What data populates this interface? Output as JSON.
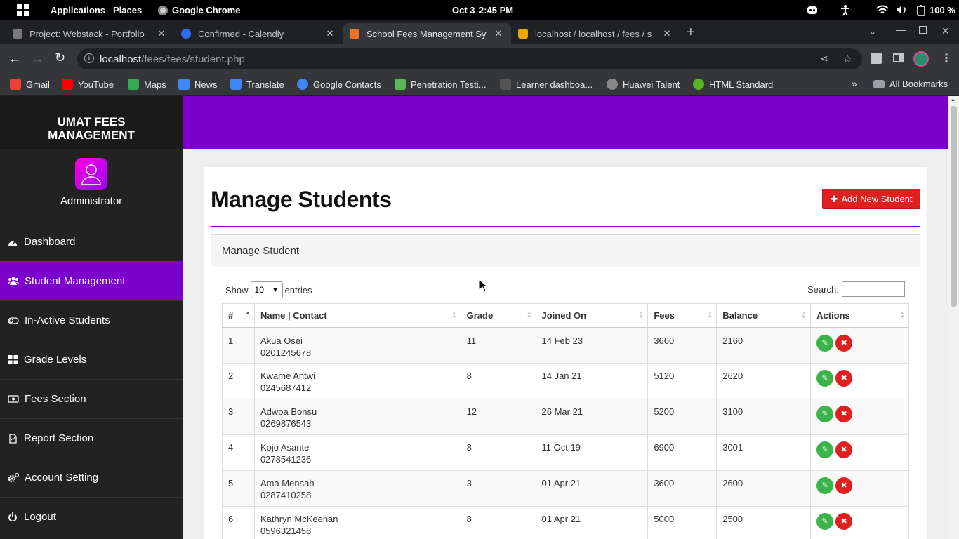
{
  "os": {
    "applications": "Applications",
    "places": "Places",
    "app": "Google Chrome",
    "date": "Oct 3",
    "time": "2:45 PM",
    "battery": "100 %"
  },
  "tabs": [
    {
      "title": "Project: Webstack - Portfolio",
      "color": "#7a7a7a"
    },
    {
      "title": "Confirmed - Calendly",
      "color": "#2f6ff5"
    },
    {
      "title": "School Fees Management Sy",
      "color": "#e8712a"
    },
    {
      "title": "localhost / localhost / fees / s",
      "color": "#e6a700"
    }
  ],
  "url": {
    "host": "localhost",
    "path": "/fees/fees/student.php"
  },
  "bookmarks": [
    {
      "label": "Gmail",
      "color": "#ea4335"
    },
    {
      "label": "YouTube",
      "color": "#ff0000"
    },
    {
      "label": "Maps",
      "color": "#34a853"
    },
    {
      "label": "News",
      "color": "#4285f4"
    },
    {
      "label": "Translate",
      "color": "#4285f4"
    },
    {
      "label": "Google Contacts",
      "color": "#4285f4"
    },
    {
      "label": "Penetration Testi...",
      "color": "#5bb55b"
    },
    {
      "label": "Learner dashboa...",
      "color": "#555555"
    },
    {
      "label": "Huawei Talent",
      "color": "#888888"
    },
    {
      "label": "HTML Standard",
      "color": "#5bb520"
    }
  ],
  "all_bookmarks": "All Bookmarks",
  "sidebar": {
    "brand_line1": "UMAT FEES",
    "brand_line2": "MANAGEMENT",
    "user": "Administrator",
    "items": [
      {
        "label": "Dashboard",
        "icon": "dashboard-icon"
      },
      {
        "label": "Student Management",
        "icon": "users-icon"
      },
      {
        "label": "In-Active Students",
        "icon": "toggle-off-icon"
      },
      {
        "label": "Grade Levels",
        "icon": "grid-icon"
      },
      {
        "label": "Fees Section",
        "icon": "money-icon"
      },
      {
        "label": "Report Section",
        "icon": "file-icon"
      },
      {
        "label": "Account Setting",
        "icon": "cogs-icon"
      },
      {
        "label": "Logout",
        "icon": "power-icon"
      }
    ]
  },
  "page": {
    "title": "Manage Students",
    "add_button": "Add New Student",
    "panel_title": "Manage Student",
    "show": "Show",
    "entries_value": "10",
    "entries": "entries",
    "search_label": "Search:"
  },
  "table": {
    "headers": [
      "#",
      "Name | Contact",
      "Grade",
      "Joined On",
      "Fees",
      "Balance",
      "Actions"
    ],
    "rows": [
      {
        "n": "1",
        "name": "Akua Osei",
        "contact": "0201245678",
        "grade": "11",
        "joined": "14 Feb 23",
        "fees": "3660",
        "balance": "2160"
      },
      {
        "n": "2",
        "name": "Kwame Antwi",
        "contact": "0245687412",
        "grade": "8",
        "joined": "14 Jan 21",
        "fees": "5120",
        "balance": "2620"
      },
      {
        "n": "3",
        "name": "Adwoa Bonsu",
        "contact": "0269876543",
        "grade": "12",
        "joined": "26 Mar 21",
        "fees": "5200",
        "balance": "3100"
      },
      {
        "n": "4",
        "name": "Kojo Asante",
        "contact": "0278541236",
        "grade": "8",
        "joined": "11 Oct 19",
        "fees": "6900",
        "balance": "3001"
      },
      {
        "n": "5",
        "name": "Ama Mensah",
        "contact": "0287410258",
        "grade": "3",
        "joined": "01 Apr 21",
        "fees": "3600",
        "balance": "2600"
      },
      {
        "n": "6",
        "name": "Kathryn McKeehan",
        "contact": "0596321458",
        "grade": "8",
        "joined": "01 Apr 21",
        "fees": "5000",
        "balance": "2500"
      }
    ]
  },
  "colors": {
    "accent": "#7b00c9",
    "danger": "#e02020",
    "success": "#3bb54a"
  }
}
